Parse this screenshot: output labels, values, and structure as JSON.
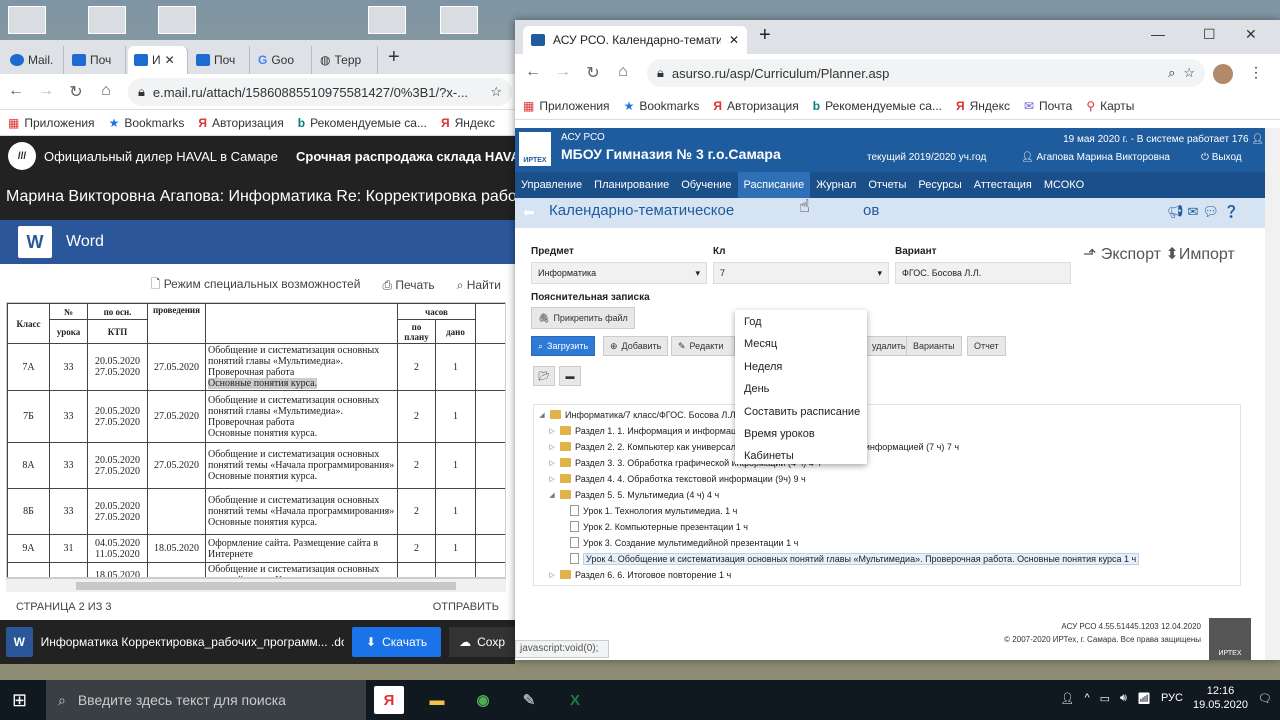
{
  "left_browser": {
    "tabs": [
      "Mail.",
      "Поч",
      "И",
      "Поч",
      "Goo",
      "Терр"
    ],
    "url": "e.mail.ru/attach/15860885510975581427/0%3B1/?x-...",
    "bookmarks": [
      "Приложения",
      "Bookmarks",
      "Авторизация",
      "Рекомендуемые са...",
      "Яндекс"
    ],
    "ad_text": "Официальный дилер HAVAL в Самаре",
    "ad_text2": "Срочная распродажа склада HAVAL",
    "subject": "Марина Викторовна Агапова: Информатика Re: Корректировка рабочих",
    "word_label": "Word",
    "word_logo": "W",
    "tools": {
      "accessibility": "Режим специальных возможностей",
      "print": "Печать",
      "find": "Найти"
    },
    "table": {
      "headers": {
        "class": "Класс",
        "lesson_no": "№",
        "lesson_no2": "урока",
        "by_ktp": "по осн.",
        "ktp": "КТП",
        "conducted": "проведения",
        "hours": "часов",
        "plan": "по плану",
        "given": "дано"
      },
      "rows": [
        {
          "cls": "7А",
          "no": "33",
          "d1": "20.05.2020",
          "d2": "27.05.2020",
          "dc": "27.05.2020",
          "topic": "Обобщение и систематизация основных понятий главы «Мультимедиа». Проверочная работа",
          "topic_hl": "Основные понятия курса.",
          "plan": "2",
          "given": "1"
        },
        {
          "cls": "7Б",
          "no": "33",
          "d1": "20.05.2020",
          "d2": "27.05.2020",
          "dc": "27.05.2020",
          "topic": "Обобщение и систематизация основных понятий главы «Мультимедиа». Проверочная работа",
          "topic_hl": "Основные понятия курса.",
          "plan": "2",
          "given": "1"
        },
        {
          "cls": "8А",
          "no": "33",
          "d1": "20.05.2020",
          "d2": "27.05.2020",
          "dc": "27.05.2020",
          "topic": "Обобщение и систематизация основных понятий темы «Начала программирования» Основные понятия курса.",
          "topic_hl": "",
          "plan": "2",
          "given": "1"
        },
        {
          "cls": "8Б",
          "no": "33",
          "d1": "20.05.2020",
          "d2": "27.05.2020",
          "dc": "",
          "topic": "Обобщение и систематизация основных понятий темы «Начала программирования» Основные понятия курса.",
          "topic_hl": "",
          "plan": "2",
          "given": "1"
        },
        {
          "cls": "9А",
          "no": "31",
          "d1": "04.05.2020",
          "d2": "11.05.2020",
          "dc": "18.05.2020",
          "topic": "Оформление сайта. Размещение сайта в Интернете",
          "topic_hl": "",
          "plan": "2",
          "given": "1"
        }
      ],
      "last_row_date": "18.05.2020",
      "last_row_topic": "Обобщение и систематизация основных понятий темы «Компьютерные ...»"
    },
    "status_page": "СТРАНИЦА 2 ИЗ 3",
    "status_send": "ОТПРАВИТЬ",
    "download": {
      "filename": "Информатика Корректировка_рабочих_программ... .docx",
      "download_label": "Скачать",
      "save_label": "Сохр"
    }
  },
  "right_browser": {
    "tab_title": "АСУ РСО. Календарно-тематиче",
    "url": "asurso.ru/asp/Curriculum/Planner.asp",
    "bookmarks": [
      "Приложения",
      "Bookmarks",
      "Авторизация",
      "Рекомендуемые са...",
      "Яндекс",
      "Почта",
      "Карты"
    ],
    "app": {
      "system": "АСУ РСО",
      "school": "МБОУ Гимназия № 3 г.о.Самара",
      "status": "19 мая 2020 г. - В системе работает 176",
      "year": "текущий 2019/2020 уч.год",
      "user": "Агапова Марина Викторовна",
      "logout": "Выход",
      "logo_text": "ИРТЕХ",
      "menu": [
        "Управление",
        "Планирование",
        "Обучение",
        "Расписание",
        "Журнал",
        "Отчеты",
        "Ресурсы",
        "Аттестация",
        "МСОКО"
      ],
      "page_title": "Календарно-тематическое",
      "page_title_tail": "ов",
      "subject_label": "Предмет",
      "subject_value": "Информатика",
      "class_label": "Кл",
      "class_value": "7",
      "variant_label": "Вариант",
      "variant_value": "ФГОС. Босова Л.Л.",
      "export_label": "Экспорт",
      "import_label": "Импорт",
      "note_label": "Пояснительная записка",
      "attach_label": "Прикрепить файл",
      "buttons": {
        "load": "Загрузить",
        "add": "Добавить",
        "edit": "Редакти",
        "delete": "удалить",
        "variants": "Варианты",
        "report": "Отчет"
      },
      "dropdown": [
        "Год",
        "Месяц",
        "Неделя",
        "День",
        "Составить расписание",
        "Время уроков",
        "Кабинеты"
      ],
      "tree": {
        "root": "Информатика/7 класс/ФГОС. Босова Л.Л. 34 ч",
        "sections": [
          "Раздел 1. 1. Информация и информационные процессы (9 ч) 9 ч",
          "Раздел 2. 2. Компьютер как универсальное устройство для работы с информацией (7 ч) 7 ч",
          "Раздел 3. 3. Обработка графической информации (4 ч) 4 ч",
          "Раздел 4. 4. Обработка текстовой информации (9ч) 9 ч",
          "Раздел 5. 5. Мультимедиа (4 ч) 4 ч"
        ],
        "lessons": [
          "Урок 1. Технология мультимедиа. 1 ч",
          "Урок 2. Компьютерные презентации 1 ч",
          "Урок 3. Создание мультимедийной презентации 1 ч",
          "Урок 4. Обобщение и систематизация основных понятий главы «Мультимедиа». Проверочная работа. Основные понятия курса 1 ч"
        ],
        "last_section": "Раздел 6. 6. Итоговое повторение 1 ч"
      },
      "footer_version": "АСУ РСО  4.55.51445.1203  12.04.2020",
      "footer_copy": "© 2007-2020 ИРТех, г. Самара. Все права защищены"
    },
    "status_link": "javascript:void(0);"
  },
  "taskbar": {
    "search_placeholder": "Введите здесь текст для поиска",
    "lang": "РУС",
    "time": "12:16",
    "date": "19.05.2020"
  }
}
